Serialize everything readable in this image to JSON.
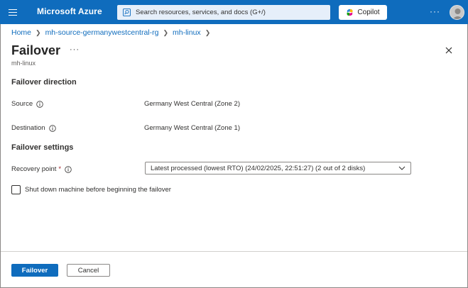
{
  "topbar": {
    "brand": "Microsoft Azure",
    "search_placeholder": "Search resources, services, and docs (G+/)",
    "copilot_label": "Copilot",
    "more_label": "···",
    "accent_color": "#0f6cbd"
  },
  "breadcrumb": {
    "items": [
      "Home",
      "mh-source-germanywestcentral-rg",
      "mh-linux"
    ]
  },
  "page": {
    "title": "Failover",
    "title_more": "···",
    "subtitle": "mh-linux",
    "close_icon": "close-icon"
  },
  "failover_direction": {
    "heading": "Failover direction",
    "source_label": "Source",
    "source_value": "Germany West Central (Zone 2)",
    "destination_label": "Destination",
    "destination_value": "Germany West Central (Zone 1)"
  },
  "failover_settings": {
    "heading": "Failover settings",
    "recovery_label": "Recovery point",
    "required_mark": "*",
    "recovery_selected": "Latest processed (lowest RTO) (24/02/2025, 22:51:27) (2 out of 2 disks)",
    "shutdown_label": "Shut down machine before beginning the failover",
    "shutdown_checked": false
  },
  "footer": {
    "primary_label": "Failover",
    "secondary_label": "Cancel"
  }
}
